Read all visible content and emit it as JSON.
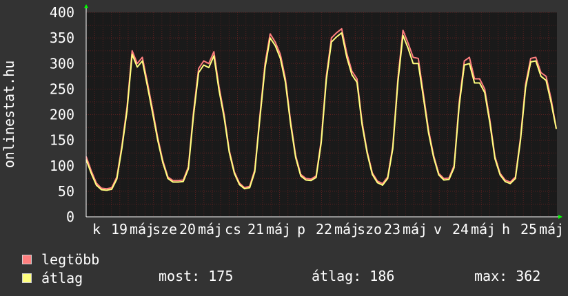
{
  "chart_data": {
    "type": "line",
    "ylabel": "onlinestat.hu",
    "ylim": [
      0,
      400
    ],
    "yticks": [
      0,
      50,
      100,
      150,
      200,
      250,
      300,
      350,
      400
    ],
    "x_tick_labels": [
      "k",
      "19",
      "máj",
      "sze",
      "20",
      "máj",
      "cs",
      "21",
      "máj",
      "p",
      "22",
      "máj",
      "szo",
      "23",
      "máj",
      "v",
      "24",
      "máj",
      "h",
      "25",
      "máj"
    ],
    "series": [
      {
        "name": "legtöbb",
        "color": "#ff7f7f",
        "values": [
          118,
          90,
          66,
          56,
          55,
          57,
          78,
          140,
          215,
          325,
          300,
          312,
          262,
          210,
          155,
          110,
          78,
          71,
          71,
          72,
          98,
          205,
          290,
          305,
          300,
          323,
          255,
          200,
          130,
          88,
          66,
          57,
          60,
          92,
          198,
          300,
          358,
          342,
          318,
          270,
          188,
          120,
          83,
          75,
          74,
          80,
          150,
          275,
          350,
          360,
          368,
          320,
          285,
          270,
          185,
          128,
          86,
          70,
          65,
          78,
          138,
          270,
          365,
          340,
          312,
          310,
          240,
          170,
          120,
          85,
          75,
          76,
          100,
          225,
          305,
          312,
          270,
          270,
          250,
          190,
          118,
          85,
          72,
          68,
          78,
          155,
          260,
          310,
          312,
          282,
          275,
          230,
          173
        ]
      },
      {
        "name": "átlag",
        "color": "#ffff7f",
        "values": [
          112,
          85,
          62,
          53,
          52,
          54,
          74,
          135,
          208,
          318,
          293,
          305,
          255,
          203,
          150,
          106,
          75,
          68,
          68,
          69,
          94,
          198,
          282,
          297,
          292,
          315,
          248,
          194,
          126,
          85,
          63,
          55,
          57,
          88,
          192,
          292,
          350,
          335,
          310,
          263,
          182,
          116,
          80,
          72,
          71,
          77,
          145,
          268,
          342,
          352,
          360,
          312,
          278,
          263,
          180,
          124,
          83,
          67,
          62,
          75,
          133,
          263,
          355,
          330,
          300,
          300,
          233,
          164,
          116,
          82,
          72,
          73,
          96,
          218,
          297,
          300,
          262,
          262,
          243,
          184,
          114,
          82,
          69,
          65,
          75,
          150,
          253,
          303,
          305,
          275,
          267,
          223,
          172
        ]
      }
    ],
    "grid": true
  },
  "legend": {
    "items": [
      {
        "label": "legtöbb",
        "color": "#ff7f7f"
      },
      {
        "label": "átlag",
        "color": "#ffff7f"
      }
    ]
  },
  "stats": {
    "most": "most: 175",
    "atlag": "átlag: 186",
    "max": "max: 362"
  },
  "colors": {
    "background": "#333333",
    "plot_background": "#1a1a1a",
    "grid": "#5a2020",
    "axis": "#ffffff",
    "arrow": "#00ff00"
  }
}
